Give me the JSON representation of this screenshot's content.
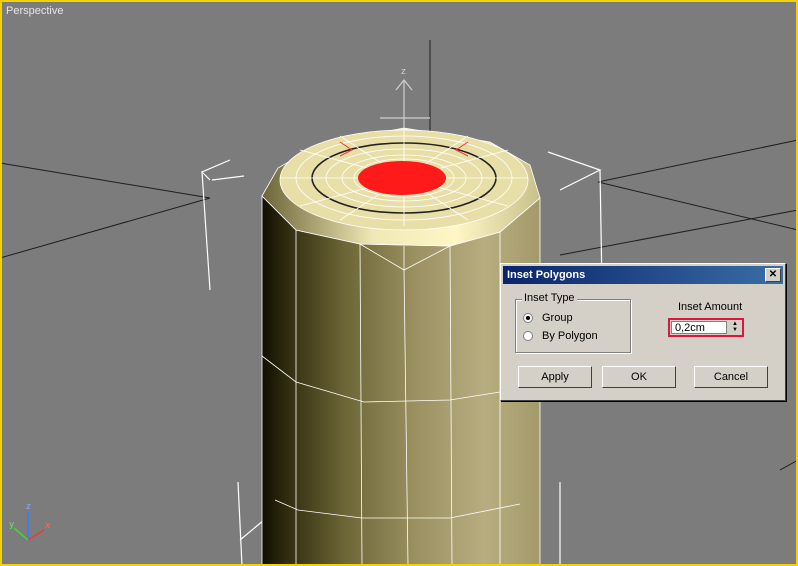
{
  "viewport": {
    "label": "Perspective",
    "border_color": "#f2d200",
    "background": "#7c7c7c",
    "selected_face_color": "#ff1a1a"
  },
  "gizmo": {
    "z_label": "z"
  },
  "axis_tripod": {
    "x_label": "x",
    "y_label": "y",
    "z_label": "z"
  },
  "dialog": {
    "title": "Inset Polygons",
    "close_icon": "close-icon",
    "inset_type": {
      "label": "Inset Type",
      "options": [
        {
          "label": "Group",
          "checked": true
        },
        {
          "label": "By Polygon",
          "checked": false
        }
      ]
    },
    "inset_amount": {
      "label": "Inset Amount",
      "value": "0,2cm"
    },
    "buttons": {
      "apply": "Apply",
      "ok": "OK",
      "cancel": "Cancel"
    },
    "highlight_color": "#e0143c"
  }
}
